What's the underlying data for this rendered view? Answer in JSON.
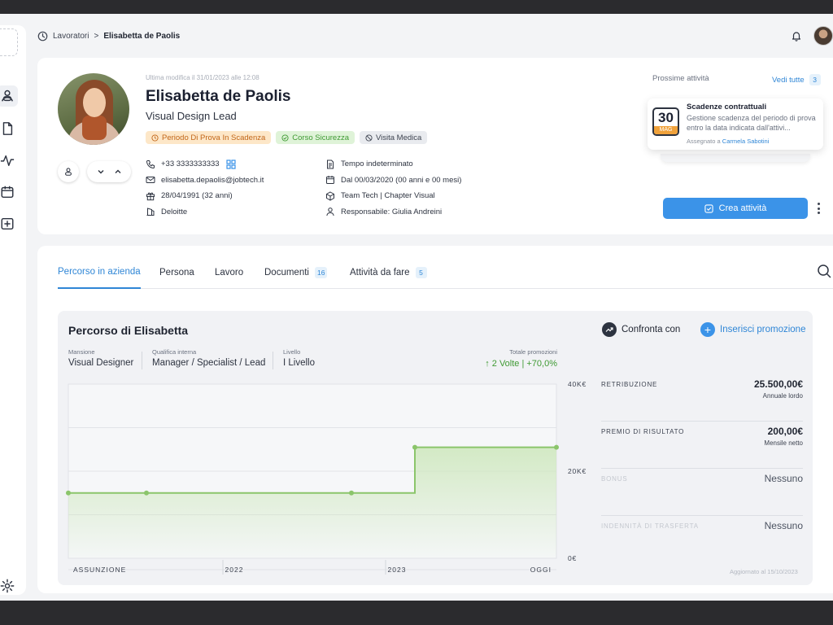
{
  "breadcrumb": {
    "parent": "Lavoratori",
    "separator": ">",
    "current": "Elisabetta de Paolis"
  },
  "profile": {
    "last_modified": "Ultima modifica il 31/01/2023 alle 12:08",
    "name": "Elisabetta de Paolis",
    "role": "Visual Design Lead",
    "badges": [
      {
        "label": "Periodo Di Prova In Scadenza",
        "tone": "orange"
      },
      {
        "label": "Corso Sicurezza",
        "tone": "green"
      },
      {
        "label": "Visita Medica",
        "tone": "gray"
      }
    ],
    "contact": {
      "phone": "+33 3333333333",
      "email": "elisabetta.depaolis@jobtech.it",
      "birth": "28/04/1991 (32 anni)",
      "company": "Deloitte"
    },
    "job": {
      "contract": "Tempo indeterminato",
      "since": "Dal 00/03/2020 (00 anni e 00 mesi)",
      "team": "Team Tech | Chapter Visual",
      "manager": "Responsabile: Giulia Andreini"
    }
  },
  "activities": {
    "label": "Prossime attività",
    "see_all": "Vedi tutte",
    "count": "3",
    "card": {
      "day": "30",
      "month": "MAG",
      "title": "Scadenze contrattuali",
      "description": "Gestione scadenza del periodo di prova entro la data indicata dall'attivi...",
      "assigned_prefix": "Assegnato a",
      "assigned_to": "Carmela Sabotini"
    },
    "create_button": "Crea attività"
  },
  "tabs": [
    {
      "label": "Percorso in azienda",
      "count": ""
    },
    {
      "label": "Persona",
      "count": ""
    },
    {
      "label": "Lavoro",
      "count": ""
    },
    {
      "label": "Documenti",
      "count": "16"
    },
    {
      "label": "Attività da fare",
      "count": "5"
    }
  ],
  "career": {
    "title": "Percorso di Elisabetta",
    "compare": "Confronta con",
    "add_promotion": "Inserisci promozione",
    "meta": [
      {
        "label": "Mansione",
        "value": "Visual Designer"
      },
      {
        "label": "Qualifica interna",
        "value": "Manager / Specialist / Lead"
      },
      {
        "label": "Livello",
        "value": "I Livello"
      }
    ],
    "totals": {
      "label": "Totale promozioni",
      "value": "↑ 2 Volte | +70,0%"
    },
    "side": [
      {
        "key": "RETRIBUZIONE",
        "value": "25.500,00€",
        "sub": "Annuale lordo",
        "faded": false
      },
      {
        "key": "PREMIO DI RISULTATO",
        "value": "200,00€",
        "sub": "Mensile netto",
        "faded": false
      },
      {
        "key": "BONUS",
        "value": "Nessuno",
        "sub": "",
        "faded": true
      },
      {
        "key": "INDENNITÀ DI TRASFERTA",
        "value": "Nessuno",
        "sub": "",
        "faded": true
      }
    ],
    "updated": "Aggiornato al 15/10/2023"
  },
  "chart_data": {
    "type": "area",
    "x_labels": [
      "ASSUNZIONE",
      "2022",
      "2023",
      "OGGI"
    ],
    "y_labels": [
      "40K€",
      "20K€",
      "0€"
    ],
    "ylim": [
      0,
      40000
    ],
    "points": [
      {
        "x": 0.0,
        "y": 15000
      },
      {
        "x": 0.16,
        "y": 15000
      },
      {
        "x": 0.58,
        "y": 15000
      },
      {
        "x": 0.71,
        "y": 15000
      },
      {
        "x": 0.71,
        "y": 25500
      },
      {
        "x": 1.0,
        "y": 25500
      }
    ],
    "markers": [
      0,
      1,
      2,
      4,
      5
    ],
    "line_color": "#8bc56b",
    "fill_color": "#cfe8bf"
  },
  "colors": {
    "accent": "#3b93e8",
    "positive": "#3f9a33",
    "warning": "#c2671a"
  }
}
